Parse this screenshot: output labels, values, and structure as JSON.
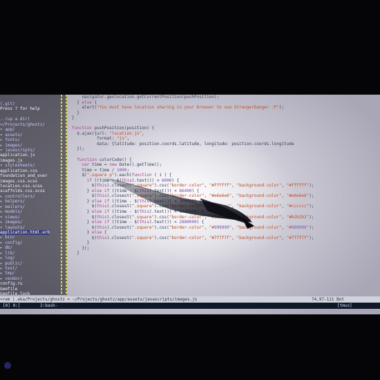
{
  "sidebar": {
    "items": [
      {
        "label": "(.git) ",
        "kind": "dir"
      },
      {
        "label": "Press ? for help",
        "kind": "file"
      },
      {
        "label": "",
        "kind": "file"
      },
      {
        "label": "..(up a dir)",
        "kind": "dir"
      },
      {
        "label": "</Projects/ghostz/",
        "kind": "dir"
      },
      {
        "label": "▾ app/",
        "kind": "dir"
      },
      {
        "label": "  ▾ assets/",
        "kind": "dir"
      },
      {
        "label": "    ▸ fonts/",
        "kind": "dir"
      },
      {
        "label": "    ▸ images/",
        "kind": "dir"
      },
      {
        "label": "    ▾ javascripts/",
        "kind": "dir"
      },
      {
        "label": "        application.js",
        "kind": "file"
      },
      {
        "label": "        images.js",
        "kind": "file"
      },
      {
        "label": "    ▾ stylesheets/",
        "kind": "dir"
      },
      {
        "label": "        application.css",
        "kind": "file"
      },
      {
        "label": "        foundation_and_over",
        "kind": "file"
      },
      {
        "label": "        images.css.scss",
        "kind": "file"
      },
      {
        "label": "        location.css.scss",
        "kind": "file"
      },
      {
        "label": "        scaffolds.css.scss",
        "kind": "file"
      },
      {
        "label": "  ▸ controllers/",
        "kind": "dir"
      },
      {
        "label": "  ▸ helpers/",
        "kind": "dir"
      },
      {
        "label": "  ▸ mailers/",
        "kind": "dir"
      },
      {
        "label": "  ▸ models/",
        "kind": "dir"
      },
      {
        "label": "  ▾ views/",
        "kind": "dir"
      },
      {
        "label": "    ▸ images/",
        "kind": "dir"
      },
      {
        "label": "    ▾ layouts/",
        "kind": "dir"
      },
      {
        "label": "        application.html.erb",
        "kind": "hl"
      },
      {
        "label": "▸ bin/",
        "kind": "dir"
      },
      {
        "label": "▸ config/",
        "kind": "dir"
      },
      {
        "label": "▸ db/",
        "kind": "dir"
      },
      {
        "label": "▸ lib/",
        "kind": "dir"
      },
      {
        "label": "▸ log/",
        "kind": "dir"
      },
      {
        "label": "▸ public/",
        "kind": "dir"
      },
      {
        "label": "▸ test/",
        "kind": "dir"
      },
      {
        "label": "▸ tmp/",
        "kind": "dir"
      },
      {
        "label": "▸ vendor/",
        "kind": "dir"
      },
      {
        "label": "  config.ru",
        "kind": "file"
      },
      {
        "label": "  Gemfile",
        "kind": "file"
      },
      {
        "label": "  Gemfile.lock",
        "kind": "file"
      },
      {
        "label": "  Rakefile",
        "kind": "file"
      },
      {
        "label": "  README.rdoc",
        "kind": "file"
      }
    ]
  },
  "code": {
    "lines": [
      {
        "n": "",
        "text": "    navigator.geolocation.getCurrentPosition(pushPosition);"
      },
      {
        "n": "",
        "text": "  } else {"
      },
      {
        "n": "",
        "text": "    alert(\"You must have location sharing in your browser to use StrangerDanger :P\");"
      },
      {
        "n": "",
        "text": "  }"
      },
      {
        "n": "",
        "text": "}"
      },
      {
        "n": "",
        "text": ""
      },
      {
        "n": "",
        "text": "function pushPosition(position) {"
      },
      {
        "n": "",
        "text": "  $.ajax({url: \"location.js\","
      },
      {
        "n": "",
        "text": "          format: \"js\","
      },
      {
        "n": "",
        "text": "          data: {latitude: position.coords.latitude, longitude: position.coords.longitude"
      },
      {
        "n": "",
        "text": "  });"
      },
      {
        "n": "",
        "text": ""
      },
      {
        "n": "",
        "text": "  function colorCode() {"
      },
      {
        "n": "",
        "text": "    var time = new Date().getTime();"
      },
      {
        "n": "",
        "text": "    time = time / 1000;"
      },
      {
        "n": "",
        "text": "    $(\".square p\").each(function ( i ) {"
      },
      {
        "n": "",
        "text": "      if ((time - $(this).text()) < 6000) {"
      },
      {
        "n": "",
        "text": "        $(this).closest(\".square\").css(\"border-color\", \"#ffffff\", \"background-color\", \"#ffffff\");"
      },
      {
        "n": "",
        "text": "      } else if ((time - $(this).text()) < 86400) {"
      },
      {
        "n": "",
        "text": "        $(this).closest(\".square\").css(\"border-color\", \"#e6e6e6\", \"background-color\", \"#e6e6e6\");"
      },
      {
        "n": "",
        "text": "      } else if ((time - $(this).text()) < 360000) {"
      },
      {
        "n": "",
        "text": "        $(this).closest(\".square\").css(\"border-color\", \"#cccccc\", \"background-color\", \"#cccccc\");"
      },
      {
        "n": "",
        "text": "      } else if ((time - $(this).text()) < 1440000) {"
      },
      {
        "n": "",
        "text": "        $(this).closest(\".square\").css(\"border-color\", \"#b2b2b2\", \"background-color\", \"#b2b2b2\");"
      },
      {
        "n": "",
        "text": "      } else if ((time - $(this).text()) < 2880000) {"
      },
      {
        "n": "",
        "text": "        $(this).closest(\".square\").css(\"border-color\", \"#999999\", \"background-color\", \"#999999\");"
      },
      {
        "n": "",
        "text": "      } else {"
      },
      {
        "n": "",
        "text": "        $(this).closest(\".square\").css(\"border-color\", \"#7f7f7f\", \"background-color\", \"#7f7f7f\");"
      },
      {
        "n": "",
        "text": "      }"
      },
      {
        "n": "",
        "text": "    });"
      },
      {
        "n": "",
        "text": "  }"
      }
    ]
  },
  "statusbar": {
    "path": "~/Projects/ghostz/app/assets/javascripts/images.js",
    "prefix": "<rem |.aka/Projects/ghostz =",
    "position": "74,97-111",
    "percent": "Bot"
  },
  "tabbar": {
    "left": "[0] 0:[",
    "session": "2:bash-",
    "right": "[tmux]"
  },
  "colors": {
    "screen_bg": "#d9d8e2",
    "sidebar_bg": "#14141e",
    "keyword": "#a0388c",
    "string": "#b8431f",
    "statusbar_bg": "#d2d2dc",
    "tabbar_bg": "#101828"
  }
}
